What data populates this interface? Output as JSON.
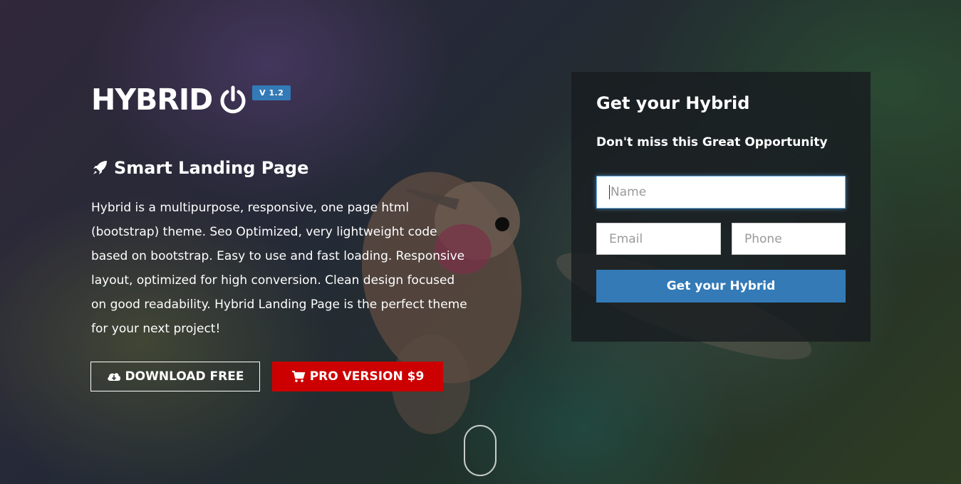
{
  "brand": {
    "name": "HYBRID",
    "version": "V 1.2",
    "icon": "power-icon"
  },
  "hero": {
    "subtitle": "Smart Landing Page",
    "subtitle_icon": "rocket-icon",
    "description": "Hybrid is a multipurpose, responsive, one page html (bootstrap) theme. Seo Optimized, very lightweight code based on bootstrap. Easy to use and fast loading. Responsive layout, optimized for high conversion. Clean design focused on good readability. Hybrid Landing Page is the perfect theme for your next project!",
    "download_label": "DOWNLOAD FREE",
    "download_icon": "cloud-download-icon",
    "pro_label": "PRO VERSION $9",
    "pro_icon": "cart-icon"
  },
  "form": {
    "title": "Get your Hybrid",
    "subtitle": "Don't miss this Great Opportunity",
    "name_placeholder": "Name",
    "email_placeholder": "Email",
    "phone_placeholder": "Phone",
    "submit_label": "Get your Hybrid"
  },
  "colors": {
    "accent": "#337ab7",
    "pro": "#cc0000",
    "panel": "#1c1f24"
  }
}
